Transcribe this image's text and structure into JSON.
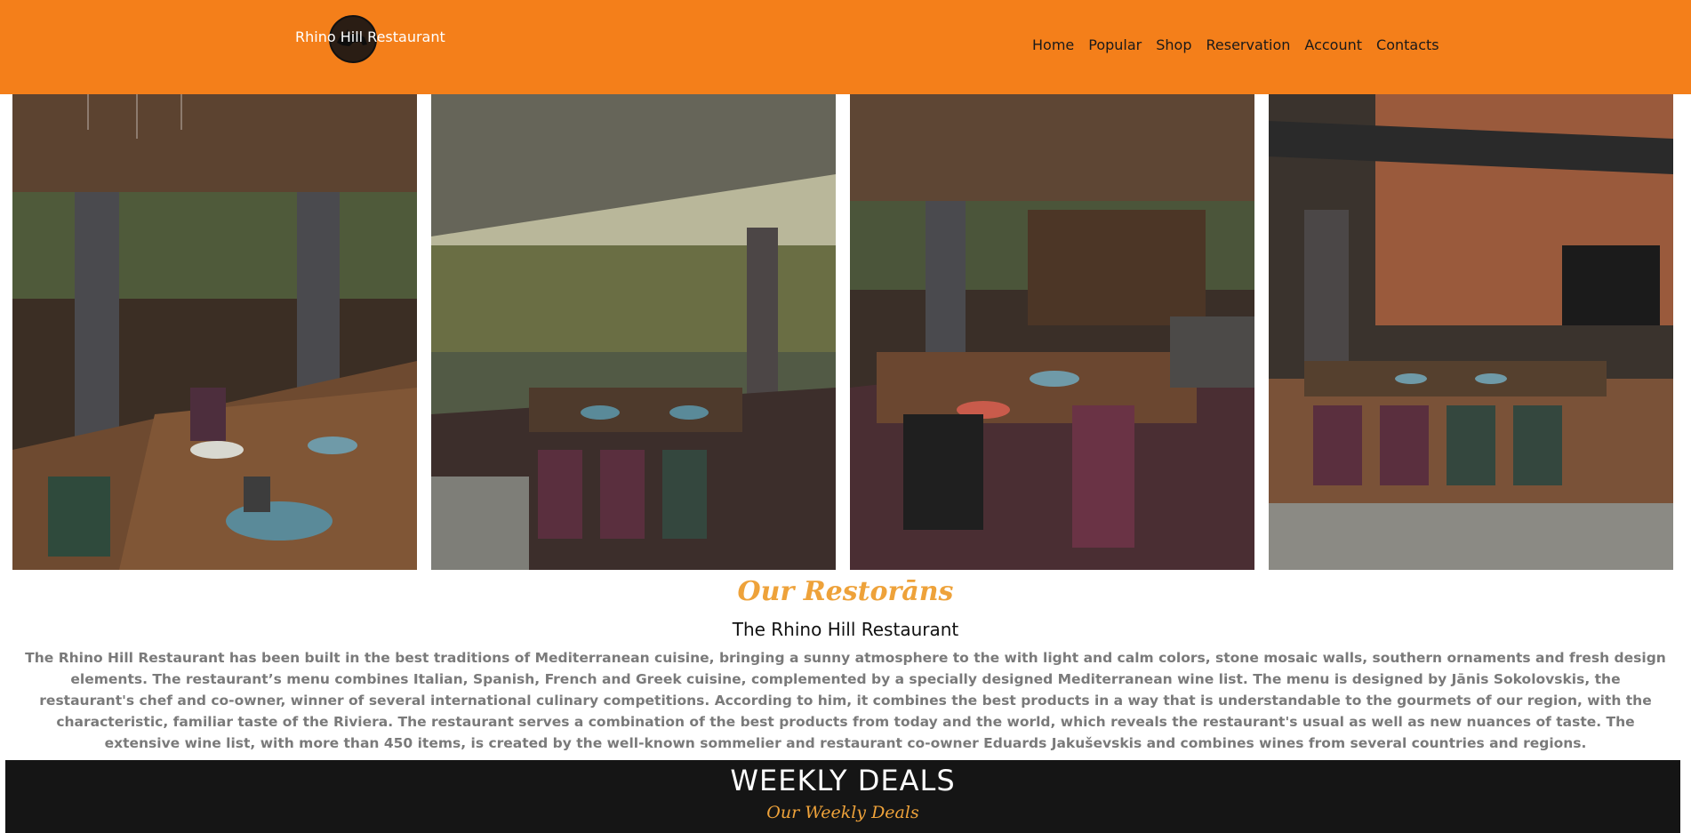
{
  "header": {
    "logo_text": "Rhino Hill Restaurant",
    "nav": [
      "Home",
      "Popular",
      "Shop",
      "Reservation",
      "Account",
      "Contacts"
    ]
  },
  "gallery": {
    "photos": [
      "restaurant-interior-photo-1",
      "restaurant-interior-photo-2",
      "restaurant-interior-photo-3",
      "restaurant-interior-photo-4"
    ]
  },
  "about": {
    "title": "Our Restorāns",
    "subtitle": "The Rhino Hill Restaurant",
    "body": "The Rhino Hill Restaurant has been built in the best traditions of Mediterranean cuisine, bringing a sunny atmosphere to the with light and calm colors, stone mosaic walls, southern ornaments and fresh design elements. The restaurant’s menu combines Italian, Spanish, French and Greek cuisine, complemented by a specially designed Mediterranean wine list. The menu is designed by Jānis Sokolovskis, the restaurant's chef and co-owner, winner of several international culinary competitions. According to him, it combines the best products in a way that is understandable to the gourmets of our region, with the characteristic, familiar taste of the Riviera. The restaurant serves a combination of the best products from today and the world, which reveals the restaurant's usual as well as new nuances of taste. The extensive wine list, with more than 450 items, is created by the well-known sommelier and restaurant co-owner Eduards Jakuševskis and combines wines from several countries and regions."
  },
  "deals": {
    "title": "WEEKLY DEALS",
    "subtitle": "Our Weekly Deals"
  },
  "colors": {
    "header_bg": "#f47f1a",
    "accent": "#eea23a",
    "deals_bg": "#151515"
  }
}
